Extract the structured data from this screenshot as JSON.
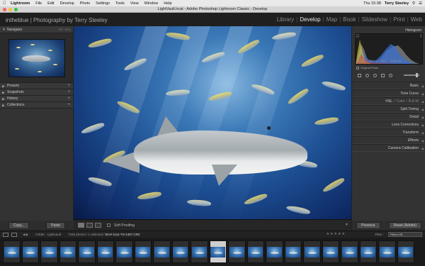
{
  "menubar": {
    "apple": "",
    "app_name": "Lightroom",
    "menus": [
      "File",
      "Edit",
      "Develop",
      "Photo",
      "Settings",
      "Tools",
      "View",
      "Window",
      "Help"
    ],
    "clock": "Thu 15:38",
    "user": "Terry Steeley"
  },
  "window": {
    "title": "LightVault.lrcat - Adobe Photoshop Lightroom Classic - Develop"
  },
  "identity_plate": "intheblue | Photography by Terry Steeley",
  "modules": [
    "Library",
    "Develop",
    "Map",
    "Book",
    "Slideshow",
    "Print",
    "Web"
  ],
  "active_module": "Develop",
  "left_panel": {
    "navigator": {
      "title": "Navigator",
      "options": [
        "FIT",
        "FILL"
      ]
    },
    "sections": [
      {
        "title": "Presets"
      },
      {
        "title": "Snapshots"
      },
      {
        "title": "History"
      },
      {
        "title": "Collections"
      }
    ],
    "copy_label": "Copy...",
    "paste_label": "Paste"
  },
  "toolbar": {
    "soft_proofing_label": "Soft Proofing"
  },
  "right_panel": {
    "histogram_title": "Histogram",
    "histogram_info": [
      "ISO 200",
      "16 mm",
      "f/6.3",
      "1/250 sec"
    ],
    "original_photo_label": "Original Photo",
    "sections": [
      {
        "title": "Basic"
      },
      {
        "title": "Tone Curve"
      },
      {
        "title": "HSL / Color / B&W",
        "parts": [
          "HSL",
          "Color",
          "B & W"
        ]
      },
      {
        "title": "Split Toning"
      },
      {
        "title": "Detail"
      },
      {
        "title": "Lens Corrections"
      },
      {
        "title": "Transform"
      },
      {
        "title": "Effects"
      },
      {
        "title": "Camera Calibration"
      }
    ],
    "previous_label": "Previous",
    "reset_label": "Reset (Adobe)"
  },
  "filmstrip_bar": {
    "source": "Folder : Lightvault",
    "count": "7348 photos / 1 selected /",
    "filename": "BAH-1111-TS-1467.CR2",
    "filter_label": "Filter :",
    "filter_value": "Filters Off"
  },
  "filmstrip": {
    "frame_count": 22,
    "selected_index": 11
  },
  "colors": {
    "menubar_bg": "#e9e9e9",
    "panel_bg": "#333333",
    "accent_active_text": "#e6e6e6",
    "water_blue": "#1d4f93"
  }
}
